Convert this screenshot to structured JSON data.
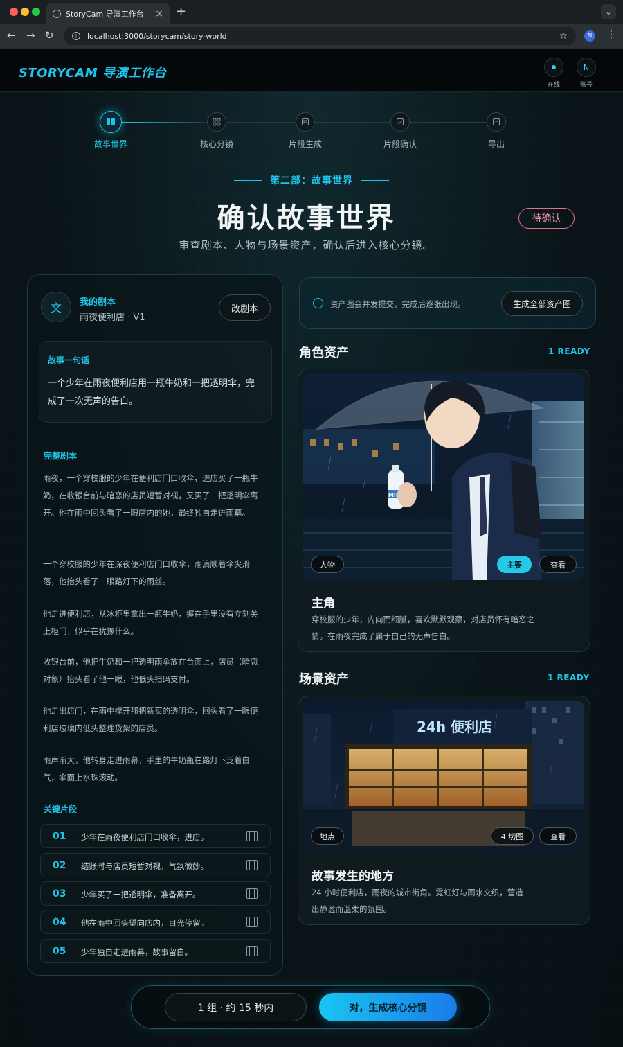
{
  "browser": {
    "tab_title": "StoryCam 导演工作台",
    "url": "localhost:3000/storycam/story-world",
    "profile_initial": "N"
  },
  "header": {
    "logo": "STORYCAM 导演工作台",
    "status_label": "在线",
    "account_initial": "N",
    "account_label": "账号"
  },
  "stepper": [
    {
      "label": "故事世界",
      "icon": "book-icon",
      "active": true
    },
    {
      "label": "核心分镜",
      "icon": "grid-icon",
      "active": false
    },
    {
      "label": "片段生成",
      "icon": "film-icon",
      "active": false
    },
    {
      "label": "片段确认",
      "icon": "check-frame-icon",
      "active": false
    },
    {
      "label": "导出",
      "icon": "export-icon",
      "active": false
    }
  ],
  "hero": {
    "part": "第二部：故事世界",
    "title": "确认故事世界",
    "subtitle": "审查剧本、人物与场景资产，确认后进入核心分镜。",
    "badge": "待确认"
  },
  "script": {
    "icon_char": "文",
    "title": "我的剧本",
    "subtitle": "雨夜便利店 · V1",
    "edit_label": "改剧本",
    "logline_label": "故事一句话",
    "logline": "一个少年在雨夜便利店用一瓶牛奶和一把透明伞，完成了一次无声的告白。",
    "full_label": "完整剧本",
    "paragraphs": [
      "雨夜，一个穿校服的少年在便利店门口收伞，进店买了一瓶牛奶，在收银台前与暗恋的店员短暂对视，又买了一把透明伞离开。他在雨中回头看了一眼店内的她，最终独自走进雨幕。",
      "一个穿校服的少年在深夜便利店门口收伞，雨滴顺着伞尖滑落，他抬头看了一眼路灯下的雨丝。",
      "他走进便利店，从冰柜里拿出一瓶牛奶，握在手里没有立刻关上柜门，似乎在犹豫什么。",
      "收银台前，他把牛奶和一把透明雨伞放在台面上，店员（暗恋对象）抬头看了他一眼，他低头扫码支付。",
      "他走出店门，在雨中撑开那把新买的透明伞，回头看了一眼便利店玻璃内低头整理货架的店员。",
      "雨声渐大，他转身走进雨幕，手里的牛奶瓶在路灯下泛着白气，伞面上水珠滚动。"
    ],
    "key_label": "关键片段",
    "segments": [
      {
        "num": "01",
        "text": "少年在雨夜便利店门口收伞，进店。"
      },
      {
        "num": "02",
        "text": "结账时与店员短暂对视，气氛微妙。"
      },
      {
        "num": "03",
        "text": "少年买了一把透明伞，准备离开。"
      },
      {
        "num": "04",
        "text": "他在雨中回头望向店内，目光停留。"
      },
      {
        "num": "05",
        "text": "少年独自走进雨幕，故事留白。"
      }
    ]
  },
  "assets": {
    "info": "资产图会并发提交，完成后逐张出现。",
    "generate_all": "生成全部资产图",
    "characters": {
      "title": "角色资产",
      "ready": "1 READY",
      "card": {
        "type_pill": "人物",
        "main_pill": "主要",
        "view_pill": "查看",
        "image_text": "MILK",
        "name": "主角",
        "desc": "穿校服的少年，内向而细腻，喜欢默默观察，对店员怀有暗恋之情。在雨夜完成了属于自己的无声告白。"
      }
    },
    "scenes": {
      "title": "场景资产",
      "ready": "1 READY",
      "card": {
        "type_pill": "地点",
        "count_pill": "4 切图",
        "view_pill": "查看",
        "sign_text": "24h 便利店",
        "name": "故事发生的地方",
        "desc": "24 小时便利店，雨夜的城市街角。霓虹灯与雨水交织，营造出静谧而温柔的氛围。"
      }
    }
  },
  "footer": {
    "group_info": "1 组 · 约 15 秒内",
    "confirm": "对，生成核心分镜"
  },
  "colors": {
    "accent": "#1fc3e8",
    "pending": "#e36f86",
    "background": "#0b1216"
  }
}
